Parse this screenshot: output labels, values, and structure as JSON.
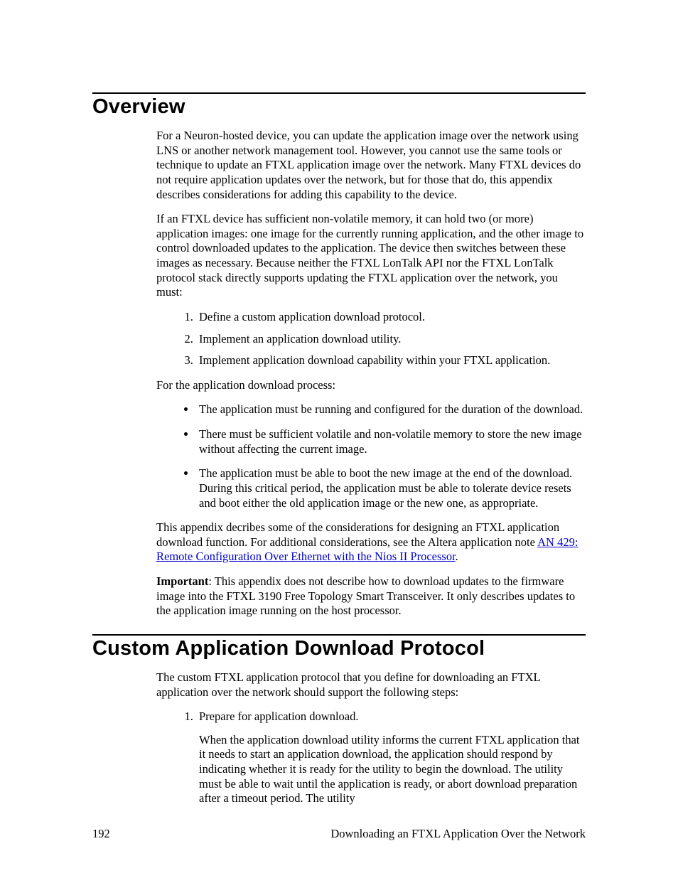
{
  "section1": {
    "heading": "Overview",
    "p1": "For a Neuron-hosted device, you can update the application image over the network using LNS or another network management tool.  However, you cannot use the same tools or technique to update an FTXL application image over the network.  Many FTXL devices do not require application updates over the network, but for those that do, this appendix describes considerations for adding this capability to the device.",
    "p2": "If an FTXL device has sufficient non-volatile memory, it can hold two (or more) application images:  one image for the currently running application, and the other image to control downloaded updates to the application.  The device then switches between these images as necessary.  Because neither the FTXL LonTalk API nor the FTXL LonTalk protocol stack directly supports updating the FTXL application over the network, you must:",
    "ol1": {
      "i1": "Define a custom application download protocol.",
      "i2": "Implement an application download utility.",
      "i3": "Implement application download capability within your FTXL application."
    },
    "p3": "For the application download process:",
    "ul1": {
      "b1": "The application must be running and configured for the duration of the download.",
      "b2": "There must be sufficient volatile and non-volatile memory to store the new image without affecting the current image.",
      "b3": "The application must be able to boot the new image at the end of the download.  During this critical period, the application must be able to tolerate device resets and boot either the old application image or the new one, as appropriate."
    },
    "p4_pre": "This appendix decribes some of the considerations for designing an FTXL application download function.  For additional considerations, see the Altera application note ",
    "p4_link": "AN 429: Remote Configuration Over Ethernet with the Nios II Processor",
    "p4_post": ".",
    "p5_label": "Important",
    "p5_rest": ":  This appendix does not describe how to download updates to the firmware image into the FTXL 3190 Free Topology Smart Transceiver.  It only describes updates to the application image running on the host processor."
  },
  "section2": {
    "heading": "Custom Application Download Protocol",
    "p1": "The custom FTXL application protocol that you define for downloading an FTXL application over the network should support the following steps:",
    "ol1": {
      "i1_lead": "Prepare for application download.",
      "i1_body": "When the application download utility informs the current FTXL application that it needs to start an application download, the application should respond by indicating whether it is ready for the utility to begin the download.  The utility must be able to wait until the application is ready, or abort download preparation after a timeout period.  The utility"
    }
  },
  "footer": {
    "page": "192",
    "title": "Downloading an FTXL Application Over the Network"
  }
}
